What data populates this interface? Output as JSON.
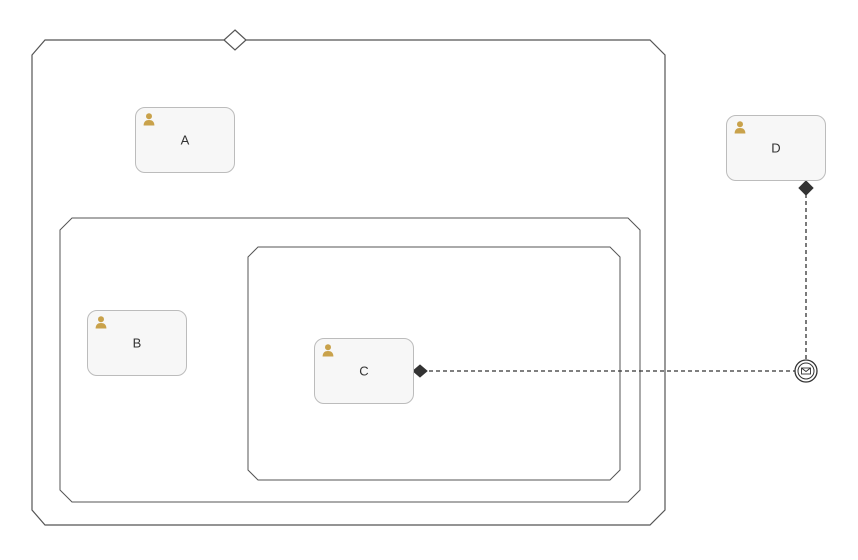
{
  "tasks": {
    "a": {
      "label": "A"
    },
    "b": {
      "label": "B"
    },
    "c": {
      "label": "C"
    },
    "d": {
      "label": "D"
    }
  },
  "icons": {
    "user": "user-icon",
    "message": "message-icon"
  }
}
